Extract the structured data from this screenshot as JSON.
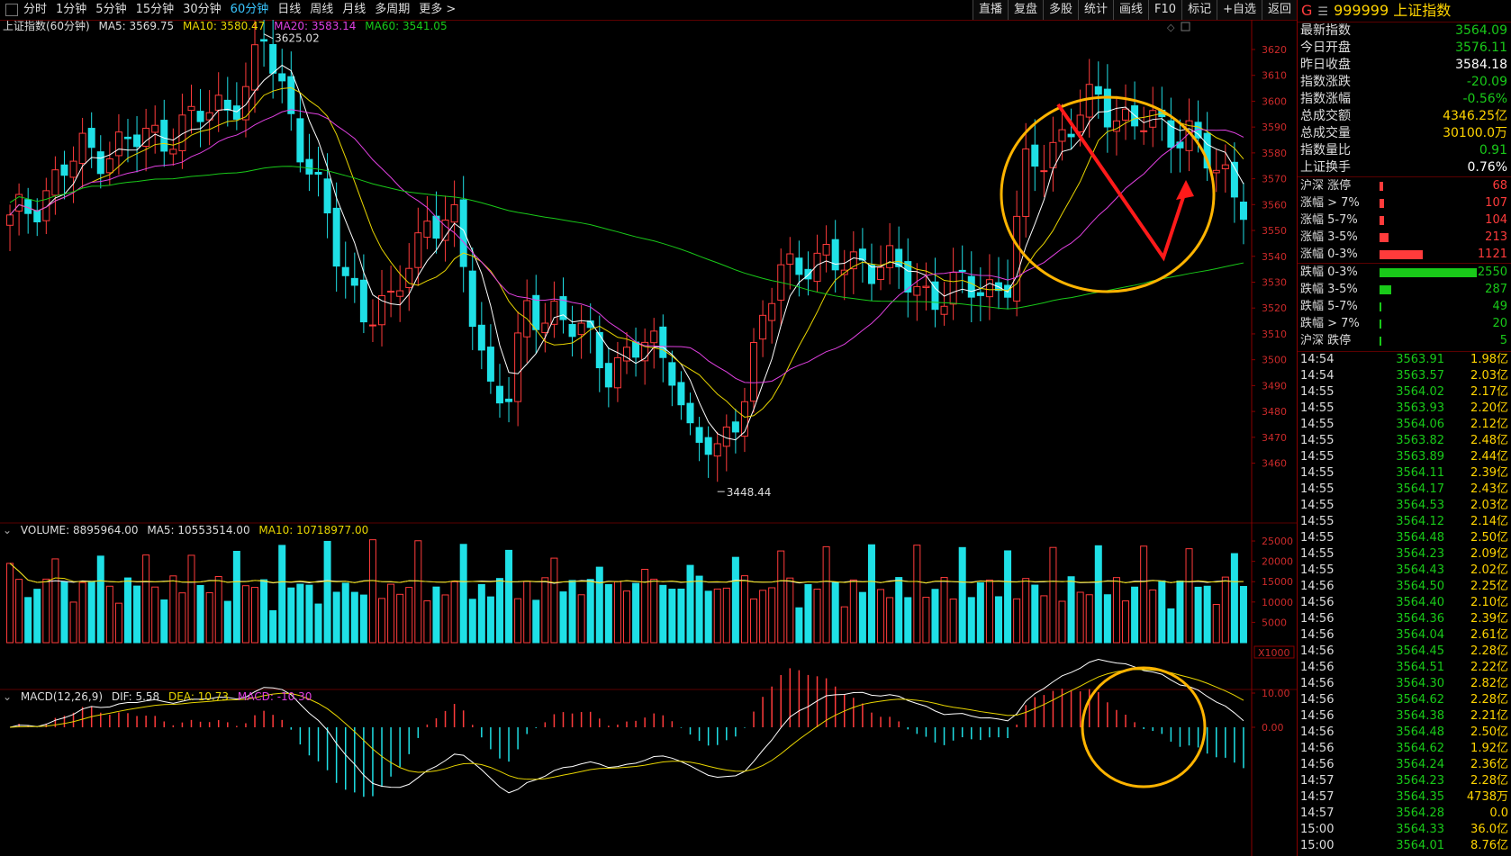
{
  "toolbar": {
    "periods": [
      "分时",
      "1分钟",
      "5分钟",
      "15分钟",
      "30分钟",
      "60分钟",
      "日线",
      "周线",
      "月线",
      "多周期",
      "更多"
    ],
    "active_period": "60分钟",
    "more_caret": ">",
    "right_buttons": [
      "直播",
      "复盘",
      "多股",
      "统计",
      "画线",
      "F10",
      "标记",
      "+自选",
      "返回"
    ]
  },
  "price_panel": {
    "title": "上证指数(60分钟)",
    "ma5": "MA5: 3569.75",
    "ma10": "MA10: 3580.47",
    "ma20": "MA20: 3583.14",
    "ma60": "MA60: 3541.05",
    "high_label": "3625.02",
    "low_label": "3448.44",
    "axis_ticks": [
      "3620",
      "3610",
      "3600",
      "3590",
      "3580",
      "3570",
      "3560",
      "3550",
      "3540",
      "3530",
      "3520",
      "3510",
      "3500",
      "3490",
      "3480",
      "3470",
      "3460"
    ]
  },
  "volume_panel": {
    "title": "VOLUME: 8895964.00",
    "ma5": "MA5: 10553514.00",
    "ma10": "MA10: 10718977.00",
    "axis_ticks": [
      "25000",
      "20000",
      "15000",
      "10000",
      "5000"
    ],
    "unit": "X1000"
  },
  "macd_panel": {
    "title": "MACD(12,26,9)",
    "dif": "DIF: 5.58",
    "dea": "DEA: 10.73",
    "macd": "MACD: -10.30",
    "axis_ticks": [
      "10.00",
      "0.00"
    ]
  },
  "colors": {
    "up": "#ff3b3b",
    "down": "#1fe0e6",
    "ma5": "#ffffff",
    "ma10": "#e8d500",
    "ma20": "#e040e0",
    "ma60": "#19c919",
    "annotation": "#ffb400",
    "arrow": "#ff1a1a"
  },
  "quote": {
    "code": "999999",
    "name": "上证指数",
    "g_label": "G",
    "menu_glyph": "☰",
    "stats": [
      {
        "label": "最新指数",
        "value": "3564.09",
        "color": "#19c919"
      },
      {
        "label": "今日开盘",
        "value": "3576.11",
        "color": "#19c919"
      },
      {
        "label": "昨日收盘",
        "value": "3584.18",
        "color": "#ffffff"
      },
      {
        "label": "指数涨跌",
        "value": "-20.09",
        "color": "#19c919"
      },
      {
        "label": "指数涨幅",
        "value": "-0.56%",
        "color": "#19c919"
      },
      {
        "label": "总成交额",
        "value": "4346.25亿",
        "color": "#ffd400"
      },
      {
        "label": "总成交量",
        "value": "30100.0万",
        "color": "#ffd400"
      },
      {
        "label": "指数量比",
        "value": "0.91",
        "color": "#19c919"
      },
      {
        "label": "上证换手",
        "value": "0.76%",
        "color": "#ffffff"
      }
    ],
    "rise_dist": [
      {
        "label": "沪深 涨停",
        "value": "68",
        "bar": 0.04
      },
      {
        "label": "涨幅 > 7%",
        "value": "107",
        "bar": 0.05
      },
      {
        "label": "涨幅 5-7%",
        "value": "104",
        "bar": 0.05
      },
      {
        "label": "涨幅 3-5%",
        "value": "213",
        "bar": 0.09
      },
      {
        "label": "涨幅 0-3%",
        "value": "1121",
        "bar": 0.45
      }
    ],
    "fall_dist": [
      {
        "label": "跌幅 0-3%",
        "value": "2550",
        "bar": 1.0
      },
      {
        "label": "跌幅 3-5%",
        "value": "287",
        "bar": 0.12
      },
      {
        "label": "跌幅 5-7%",
        "value": "49",
        "bar": 0.02
      },
      {
        "label": "跌幅 > 7%",
        "value": "20",
        "bar": 0.01
      },
      {
        "label": "沪深 跌停",
        "value": "5",
        "bar": 0.01
      }
    ],
    "ticks": [
      {
        "t": "14:54",
        "p": "3563.91",
        "v": "1.98亿"
      },
      {
        "t": "14:54",
        "p": "3563.57",
        "v": "2.03亿"
      },
      {
        "t": "14:55",
        "p": "3564.02",
        "v": "2.17亿"
      },
      {
        "t": "14:55",
        "p": "3563.93",
        "v": "2.20亿"
      },
      {
        "t": "14:55",
        "p": "3564.06",
        "v": "2.12亿"
      },
      {
        "t": "14:55",
        "p": "3563.82",
        "v": "2.48亿"
      },
      {
        "t": "14:55",
        "p": "3563.89",
        "v": "2.44亿"
      },
      {
        "t": "14:55",
        "p": "3564.11",
        "v": "2.39亿"
      },
      {
        "t": "14:55",
        "p": "3564.17",
        "v": "2.43亿"
      },
      {
        "t": "14:55",
        "p": "3564.53",
        "v": "2.03亿"
      },
      {
        "t": "14:55",
        "p": "3564.12",
        "v": "2.14亿"
      },
      {
        "t": "14:55",
        "p": "3564.48",
        "v": "2.50亿"
      },
      {
        "t": "14:55",
        "p": "3564.23",
        "v": "2.09亿"
      },
      {
        "t": "14:55",
        "p": "3564.43",
        "v": "2.02亿"
      },
      {
        "t": "14:56",
        "p": "3564.50",
        "v": "2.25亿"
      },
      {
        "t": "14:56",
        "p": "3564.40",
        "v": "2.10亿"
      },
      {
        "t": "14:56",
        "p": "3564.36",
        "v": "2.39亿"
      },
      {
        "t": "14:56",
        "p": "3564.04",
        "v": "2.61亿"
      },
      {
        "t": "14:56",
        "p": "3564.45",
        "v": "2.28亿"
      },
      {
        "t": "14:56",
        "p": "3564.51",
        "v": "2.22亿"
      },
      {
        "t": "14:56",
        "p": "3564.30",
        "v": "2.82亿"
      },
      {
        "t": "14:56",
        "p": "3564.62",
        "v": "2.28亿"
      },
      {
        "t": "14:56",
        "p": "3564.38",
        "v": "2.21亿"
      },
      {
        "t": "14:56",
        "p": "3564.48",
        "v": "2.50亿"
      },
      {
        "t": "14:56",
        "p": "3564.62",
        "v": "1.92亿"
      },
      {
        "t": "14:56",
        "p": "3564.24",
        "v": "2.36亿"
      },
      {
        "t": "14:57",
        "p": "3564.23",
        "v": "2.28亿"
      },
      {
        "t": "14:57",
        "p": "3564.35",
        "v": "4738万"
      },
      {
        "t": "14:57",
        "p": "3564.28",
        "v": "0.0"
      },
      {
        "t": "15:00",
        "p": "3564.33",
        "v": "36.0亿"
      },
      {
        "t": "15:00",
        "p": "3564.01",
        "v": "8.76亿"
      }
    ]
  }
}
